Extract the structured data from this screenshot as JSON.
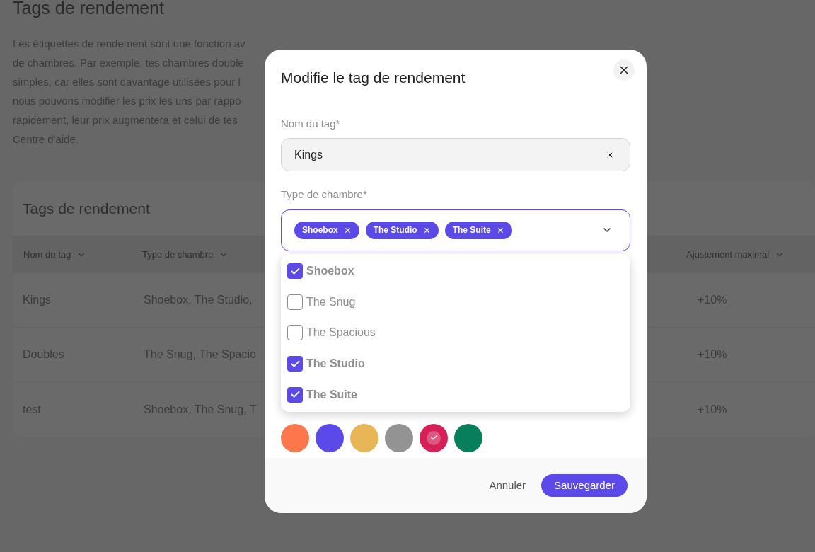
{
  "page": {
    "title": "Tags de rendement",
    "intro_lines": [
      "Les étiquettes de rendement sont une fonction av",
      "de chambres. Par exemple, tes chambres double",
      "simples, car elles sont davantage utilisées pour l",
      "nous pouvons modifier les prix les uns par rappo",
      "rapidement, leur prix augmentera et celui de tes",
      "Centre d'aide."
    ]
  },
  "table": {
    "title": "Tags de rendement",
    "columns": [
      {
        "label": "Nom du tag"
      },
      {
        "label": "Type de chambre"
      },
      {
        "label": "Ajustement maximal"
      }
    ],
    "rows": [
      {
        "name": "Kings",
        "room_types": "Shoebox, The Studio,",
        "max_adjustment": "+10%"
      },
      {
        "name": "Doubles",
        "room_types": "The Snug, The Spacio",
        "max_adjustment": "+10%"
      },
      {
        "name": "test",
        "room_types": "Shoebox, The Snug, T",
        "max_adjustment": "+10%"
      }
    ]
  },
  "dialog": {
    "title": "Modifie le tag de rendement",
    "name_field": {
      "label": "Nom du tag*",
      "value": "Kings"
    },
    "room_field": {
      "label": "Type de chambre*",
      "chips": [
        "Shoebox",
        "The Studio",
        "The Suite"
      ],
      "expanded": true,
      "options": [
        {
          "label": "Shoebox",
          "checked": true
        },
        {
          "label": "The Snug",
          "checked": false
        },
        {
          "label": "The Spacious",
          "checked": false
        },
        {
          "label": "The Studio",
          "checked": true
        },
        {
          "label": "The Suite",
          "checked": true
        }
      ]
    },
    "colors": [
      {
        "color": "#fd774c",
        "selected": false
      },
      {
        "color": "#5b4ae8",
        "selected": false
      },
      {
        "color": "#e8b657",
        "selected": false
      },
      {
        "color": "#939393",
        "selected": false
      },
      {
        "color": "#d52158",
        "selected": true
      },
      {
        "color": "#087f5b",
        "selected": false
      }
    ],
    "buttons": {
      "cancel": "Annuler",
      "save": "Sauvegarder"
    }
  }
}
